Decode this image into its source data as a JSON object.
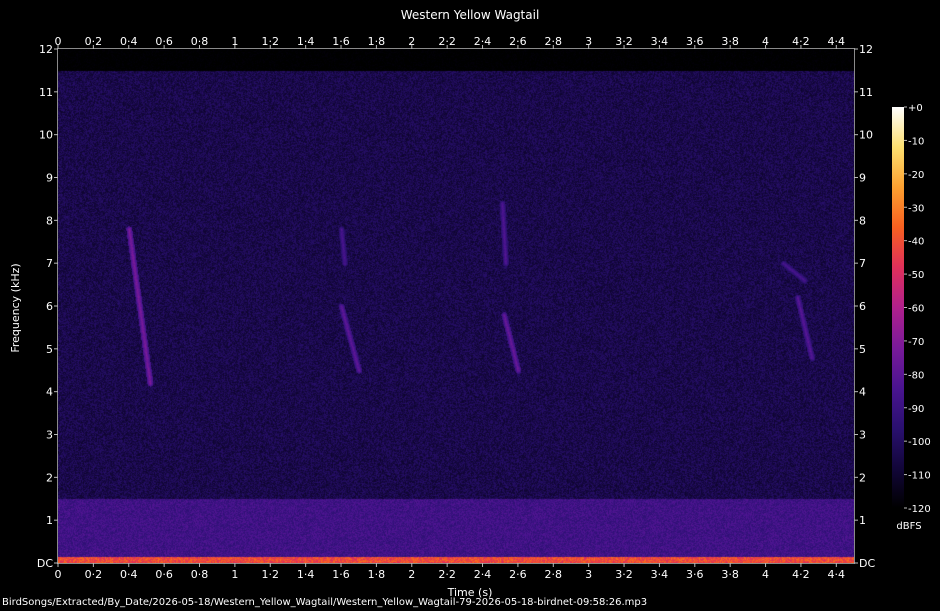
{
  "chart_data": {
    "type": "heatmap",
    "title": "Western Yellow Wagtail",
    "xlabel": "Time (s)",
    "ylabel": "Frequency (kHz)",
    "xlim": [
      0,
      4.5
    ],
    "ylim": [
      0,
      12
    ],
    "x_ticks": [
      "0",
      "0·2",
      "0·4",
      "0·6",
      "0·8",
      "1",
      "1·2",
      "1·4",
      "1·6",
      "1·8",
      "2",
      "2·2",
      "2·4",
      "2·6",
      "2·8",
      "3",
      "3·2",
      "3·4",
      "3·6",
      "3·8",
      "4",
      "4·2",
      "4·4"
    ],
    "x_tick_values": [
      0,
      0.2,
      0.4,
      0.6,
      0.8,
      1.0,
      1.2,
      1.4,
      1.6,
      1.8,
      2.0,
      2.2,
      2.4,
      2.6,
      2.8,
      3.0,
      3.2,
      3.4,
      3.6,
      3.8,
      4.0,
      4.2,
      4.4
    ],
    "y_ticks": [
      "DC",
      "1",
      "2",
      "3",
      "4",
      "5",
      "6",
      "7",
      "8",
      "9",
      "10",
      "11",
      "12"
    ],
    "y_tick_values": [
      0,
      1,
      2,
      3,
      4,
      5,
      6,
      7,
      8,
      9,
      10,
      11,
      12
    ],
    "colorbar": {
      "label": "dBFS",
      "ticks": [
        "+0",
        "-10",
        "-20",
        "-30",
        "-40",
        "-50",
        "-60",
        "-70",
        "-80",
        "-90",
        "-100",
        "-110",
        "-120"
      ],
      "tick_values": [
        0,
        -10,
        -20,
        -30,
        -40,
        -50,
        -60,
        -70,
        -80,
        -90,
        -100,
        -110,
        -120
      ],
      "range": [
        -120,
        0
      ]
    },
    "colormap": [
      "#000000",
      "#12063a",
      "#2a1070",
      "#4a1490",
      "#7a1a9a",
      "#b0208c",
      "#e0305a",
      "#f86020",
      "#fca030",
      "#fde070",
      "#ffffff"
    ],
    "noise_floor_max_khz": 11.5,
    "calls": [
      {
        "t_start": 0.4,
        "t_end": 0.52,
        "f_start": 7.8,
        "f_end": 4.2,
        "level_db": -72
      },
      {
        "t_start": 1.6,
        "t_end": 1.7,
        "f_start": 6.0,
        "f_end": 4.5,
        "level_db": -78
      },
      {
        "t_start": 1.6,
        "t_end": 1.62,
        "f_start": 7.8,
        "f_end": 7.0,
        "level_db": -84
      },
      {
        "t_start": 2.52,
        "t_end": 2.6,
        "f_start": 5.8,
        "f_end": 4.5,
        "level_db": -76
      },
      {
        "t_start": 2.51,
        "t_end": 2.53,
        "f_start": 8.4,
        "f_end": 7.0,
        "level_db": -82
      },
      {
        "t_start": 4.18,
        "t_end": 4.26,
        "f_start": 6.2,
        "f_end": 4.8,
        "level_db": -80
      },
      {
        "t_start": 4.1,
        "t_end": 4.22,
        "f_start": 7.0,
        "f_end": 6.6,
        "level_db": -84
      }
    ],
    "low_band": {
      "f_max_khz": 1.5,
      "level_db": -82
    },
    "dc_band": {
      "f_max_khz": 0.15,
      "level_db": -40
    }
  },
  "footer": {
    "filename": "BirdSongs/Extracted/By_Date/2026-05-18/Western_Yellow_Wagtail/Western_Yellow_Wagtail-79-2026-05-18-birdnet-09:58:26.mp3"
  }
}
